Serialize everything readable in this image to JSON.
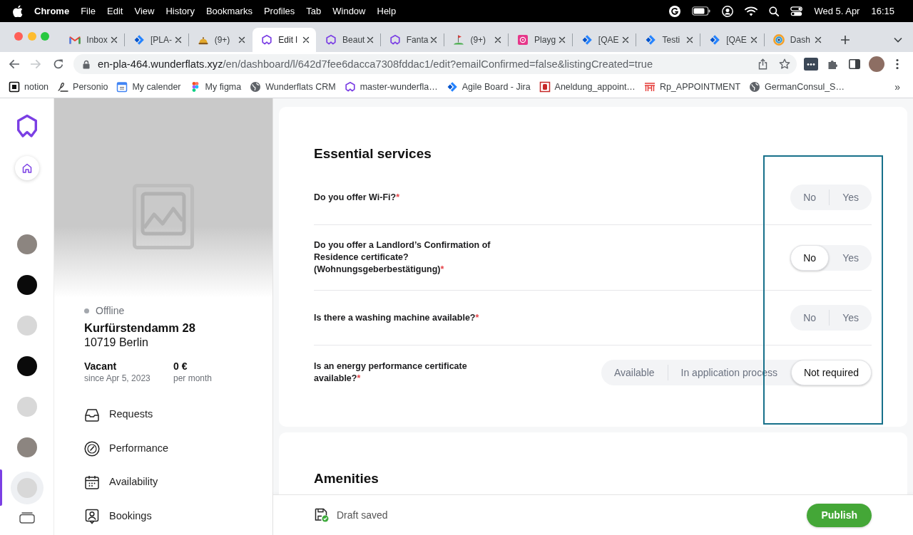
{
  "menu_bar": {
    "app": "Chrome",
    "menus": [
      "File",
      "Edit",
      "View",
      "History",
      "Bookmarks",
      "Profiles",
      "Tab",
      "Window",
      "Help"
    ],
    "date": "Wed 5. Apr",
    "time": "16:15"
  },
  "tabs": [
    {
      "title": "Inbox",
      "kind": "mail",
      "selected": false
    },
    {
      "title": "[PLA-",
      "kind": "chevrons",
      "selected": false
    },
    {
      "title": "(9+)",
      "kind": "bell",
      "selected": false
    },
    {
      "title": "Edit l",
      "kind": "hexagon",
      "selected": true
    },
    {
      "title": "Beaut",
      "kind": "hexagon",
      "selected": false
    },
    {
      "title": "Fanta",
      "kind": "hexagon",
      "selected": false
    },
    {
      "title": "(9+)",
      "kind": "golf",
      "selected": false
    },
    {
      "title": "Playg",
      "kind": "flower",
      "selected": false
    },
    {
      "title": "[QAE",
      "kind": "chevrons",
      "selected": false
    },
    {
      "title": "Testi",
      "kind": "chevrons",
      "selected": false
    },
    {
      "title": "[QAE",
      "kind": "chevrons",
      "selected": false
    },
    {
      "title": "Dash",
      "kind": "ring",
      "selected": false
    }
  ],
  "toolbar": {
    "forward_disabled": true,
    "url_host": "en-pla-464.wunderflats.xyz",
    "url_path": "/en/dashboard/l/642d7fee6dacca7308fddac1/edit?emailConfirmed=false&listingCreated=true"
  },
  "bookmarks": {
    "items": [
      {
        "title": "notion",
        "kind": "square"
      },
      {
        "title": "Personio",
        "kind": "signature"
      },
      {
        "title": "My calender",
        "kind": "calendar"
      },
      {
        "title": "My figma",
        "kind": "shapes"
      },
      {
        "title": "Wunderflats CRM",
        "kind": "globe"
      },
      {
        "title": "master-wunderfla…",
        "kind": "hexagon"
      },
      {
        "title": "Agile Board - Jira",
        "kind": "chevrons"
      },
      {
        "title": "Aneldung_appoint…",
        "kind": "framed"
      },
      {
        "title": "Rp_APPOINTMENT",
        "kind": "gate"
      },
      {
        "title": "GermanConsul_S…",
        "kind": "globe"
      }
    ],
    "overflow": "»"
  },
  "nav_rail": {
    "listings": [
      {
        "kind": "photo",
        "selected": false
      },
      {
        "kind": "logo",
        "selected": false
      },
      {
        "kind": "placeholder",
        "selected": false
      },
      {
        "kind": "logo",
        "selected": false
      },
      {
        "kind": "placeholder",
        "selected": false
      },
      {
        "kind": "photo",
        "selected": false
      },
      {
        "kind": "placeholder",
        "selected": true
      }
    ]
  },
  "listing": {
    "online": false,
    "status": "Offline",
    "street": "Kurfürstendamm 28",
    "city": "10719 Berlin",
    "facts": [
      {
        "value": "Vacant",
        "caption": "since Apr 5, 2023"
      },
      {
        "value": "0 €",
        "caption": "per month"
      }
    ],
    "menu": [
      {
        "label": "Requests",
        "kind": "inbox"
      },
      {
        "label": "Performance",
        "kind": "gauge"
      },
      {
        "label": "Availability",
        "kind": "calendar"
      },
      {
        "label": "Bookings",
        "kind": "person"
      }
    ]
  },
  "sections": [
    {
      "title": "Essential services",
      "questions": [
        {
          "label": "Do you offer Wi-Fi?",
          "required_mark": "*",
          "options": [
            {
              "label": "No",
              "selected": false
            },
            {
              "label": "Yes",
              "selected": false
            }
          ]
        },
        {
          "label": "Do you offer a Landlord’s Confirmation of Residence certificate? (Wohnungsgeberbestätigung)",
          "required_mark": "*",
          "options": [
            {
              "label": "No",
              "selected": true
            },
            {
              "label": "Yes",
              "selected": false
            }
          ]
        },
        {
          "label": "Is there a washing machine available?",
          "required_mark": "*",
          "options": [
            {
              "label": "No",
              "selected": false
            },
            {
              "label": "Yes",
              "selected": false
            }
          ]
        },
        {
          "label": "Is an energy performance certificate available?",
          "required_mark": "*",
          "options": [
            {
              "label": "Available",
              "selected": false
            },
            {
              "label": "In application process",
              "selected": false
            },
            {
              "label": "Not required",
              "selected": true
            }
          ]
        }
      ]
    },
    {
      "title": "Amenities"
    }
  ],
  "annotation": {
    "kind": "rectangle"
  },
  "footer": {
    "status": "Draft saved",
    "publish": "Publish"
  }
}
